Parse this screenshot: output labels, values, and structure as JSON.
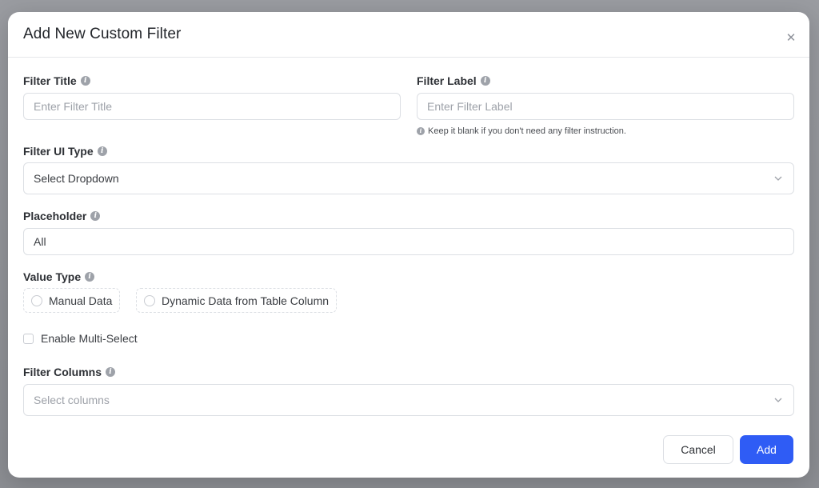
{
  "modal": {
    "title": "Add New Custom Filter",
    "close_glyph": "✕"
  },
  "filter_title": {
    "label": "Filter Title",
    "placeholder": "Enter Filter Title",
    "value": ""
  },
  "filter_label": {
    "label": "Filter Label",
    "placeholder": "Enter Filter Label",
    "value": "",
    "hint": "Keep it blank if you don't need any filter instruction."
  },
  "filter_ui_type": {
    "label": "Filter UI Type",
    "selected": "Select Dropdown"
  },
  "placeholder_field": {
    "label": "Placeholder",
    "value": "All",
    "placeholder": ""
  },
  "value_type": {
    "label": "Value Type",
    "options": [
      "Manual Data",
      "Dynamic Data from Table Column"
    ]
  },
  "multi_select": {
    "label": "Enable Multi-Select",
    "checked": false
  },
  "filter_columns": {
    "label": "Filter Columns",
    "placeholder": "Select columns"
  },
  "actions": {
    "cancel_label": "Cancel",
    "add_label": "Add"
  },
  "icons": {
    "info": "info-icon",
    "chevron": "chevron-down-icon",
    "close": "close-icon"
  },
  "colors": {
    "primary": "#2f5cf5",
    "border": "#dcdfe4",
    "text": "#2d3035",
    "muted": "#9da1a8"
  }
}
